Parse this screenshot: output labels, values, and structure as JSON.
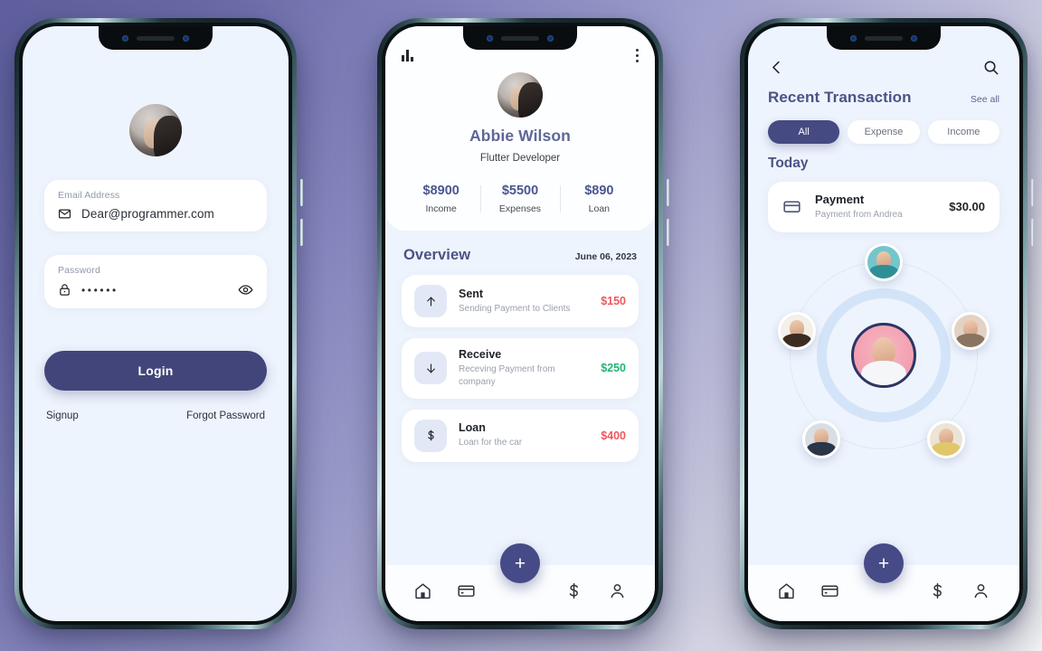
{
  "phone1": {
    "name": "login-screen",
    "avatar_icon": "user-avatar",
    "email_field": {
      "label": "Email Address",
      "value": "Dear@programmer.com",
      "icon": "envelope-icon"
    },
    "password_field": {
      "label": "Password",
      "value": "••••••",
      "icon": "lock-icon",
      "toggle_icon": "eye-icon"
    },
    "login_button": "Login",
    "signup_link": "Signup",
    "forgot_link": "Forgot Password"
  },
  "phone2": {
    "name": "dashboard-screen",
    "chart_icon": "bar-chart-icon",
    "menu_icon": "more-vertical-icon",
    "profile": {
      "avatar_icon": "user-avatar",
      "name": "Abbie Wilson",
      "role": "Flutter Developer"
    },
    "stats": [
      {
        "amount": "$8900",
        "label": "Income"
      },
      {
        "amount": "$5500",
        "label": "Expenses"
      },
      {
        "amount": "$890",
        "label": "Loan"
      }
    ],
    "overview": {
      "title": "Overview",
      "date": "June 06, 2023"
    },
    "transactions": [
      {
        "icon": "arrow-up-icon",
        "title": "Sent",
        "subtitle": "Sending Payment to Clients",
        "amount": "$150",
        "amount_color": "#f0575f"
      },
      {
        "icon": "arrow-down-icon",
        "title": "Receive",
        "subtitle": "Receving Payment from company",
        "amount": "$250",
        "amount_color": "#21b573"
      },
      {
        "icon": "dollar-icon",
        "title": "Loan",
        "subtitle": "Loan for the car",
        "amount": "$400",
        "amount_color": "#f0575f"
      }
    ],
    "nav": {
      "home": "home-icon",
      "card": "card-icon",
      "fab": "+",
      "dollar": "dollar-icon",
      "profile": "person-icon"
    }
  },
  "phone3": {
    "name": "recent-transaction-screen",
    "back_icon": "back-chevron-icon",
    "search_icon": "search-icon",
    "title": "Recent Transaction",
    "see_all": "See all",
    "filters": [
      {
        "label": "All",
        "active": true
      },
      {
        "label": "Expense",
        "active": false
      },
      {
        "label": "Income",
        "active": false
      }
    ],
    "section_label": "Today",
    "transaction": {
      "icon": "credit-card-icon",
      "title": "Payment",
      "subtitle": "Payment from Andrea",
      "amount": "$30.00"
    },
    "contacts": {
      "center_avatar": "center-contact-avatar",
      "satellites": [
        "contact-avatar-1",
        "contact-avatar-2",
        "contact-avatar-3",
        "contact-avatar-4",
        "contact-avatar-5"
      ]
    },
    "nav": {
      "home": "home-icon",
      "card": "card-icon",
      "fab": "+",
      "dollar": "dollar-icon",
      "profile": "person-icon"
    }
  },
  "theme": {
    "accent": "#414579",
    "screen_bg": "#eef4fd",
    "heading": "#4b5385"
  }
}
